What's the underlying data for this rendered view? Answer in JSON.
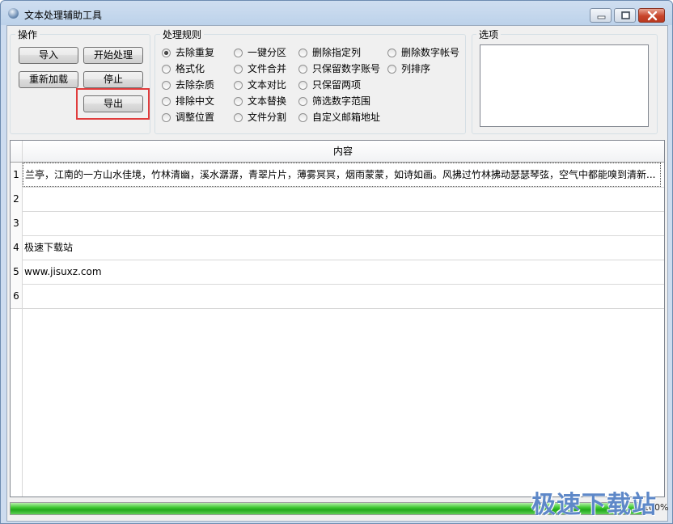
{
  "window": {
    "title": "文本处理辅助工具"
  },
  "operations": {
    "label": "操作",
    "import": "导入",
    "start": "开始处理",
    "reload": "重新加载",
    "stop": "停止",
    "export": "导出"
  },
  "rules": {
    "label": "处理规则",
    "items": [
      {
        "label": "去除重复",
        "checked": true
      },
      {
        "label": "格式化",
        "checked": false
      },
      {
        "label": "去除杂质",
        "checked": false
      },
      {
        "label": "排除中文",
        "checked": false
      },
      {
        "label": "调整位置",
        "checked": false
      },
      {
        "label": "一键分区",
        "checked": false
      },
      {
        "label": "文件合并",
        "checked": false
      },
      {
        "label": "文本对比",
        "checked": false
      },
      {
        "label": "文本替换",
        "checked": false
      },
      {
        "label": "文件分割",
        "checked": false
      },
      {
        "label": "删除指定列",
        "checked": false
      },
      {
        "label": "只保留数字账号",
        "checked": false
      },
      {
        "label": "只保留两项",
        "checked": false
      },
      {
        "label": "筛选数字范围",
        "checked": false
      },
      {
        "label": "自定义邮箱地址",
        "checked": false
      },
      {
        "label": "删除数字帐号",
        "checked": false
      },
      {
        "label": "列排序",
        "checked": false
      }
    ]
  },
  "options": {
    "label": "选项"
  },
  "grid": {
    "column_header": "内容",
    "rows": [
      {
        "num": "1",
        "text": "兰亭，江南的一方山水佳境，竹林清幽，溪水潺潺，青翠片片，薄雾冥冥，烟雨蒙蒙，如诗如画。风拂过竹林拂动瑟瑟琴弦，空气中都能嗅到清新..."
      },
      {
        "num": "2",
        "text": ""
      },
      {
        "num": "3",
        "text": ""
      },
      {
        "num": "4",
        "text": "极速下载站"
      },
      {
        "num": "5",
        "text": "www.jisuxz.com"
      },
      {
        "num": "6",
        "text": ""
      }
    ]
  },
  "progress": {
    "value": 1.0,
    "label": "100%"
  },
  "watermark": "极速下载站"
}
